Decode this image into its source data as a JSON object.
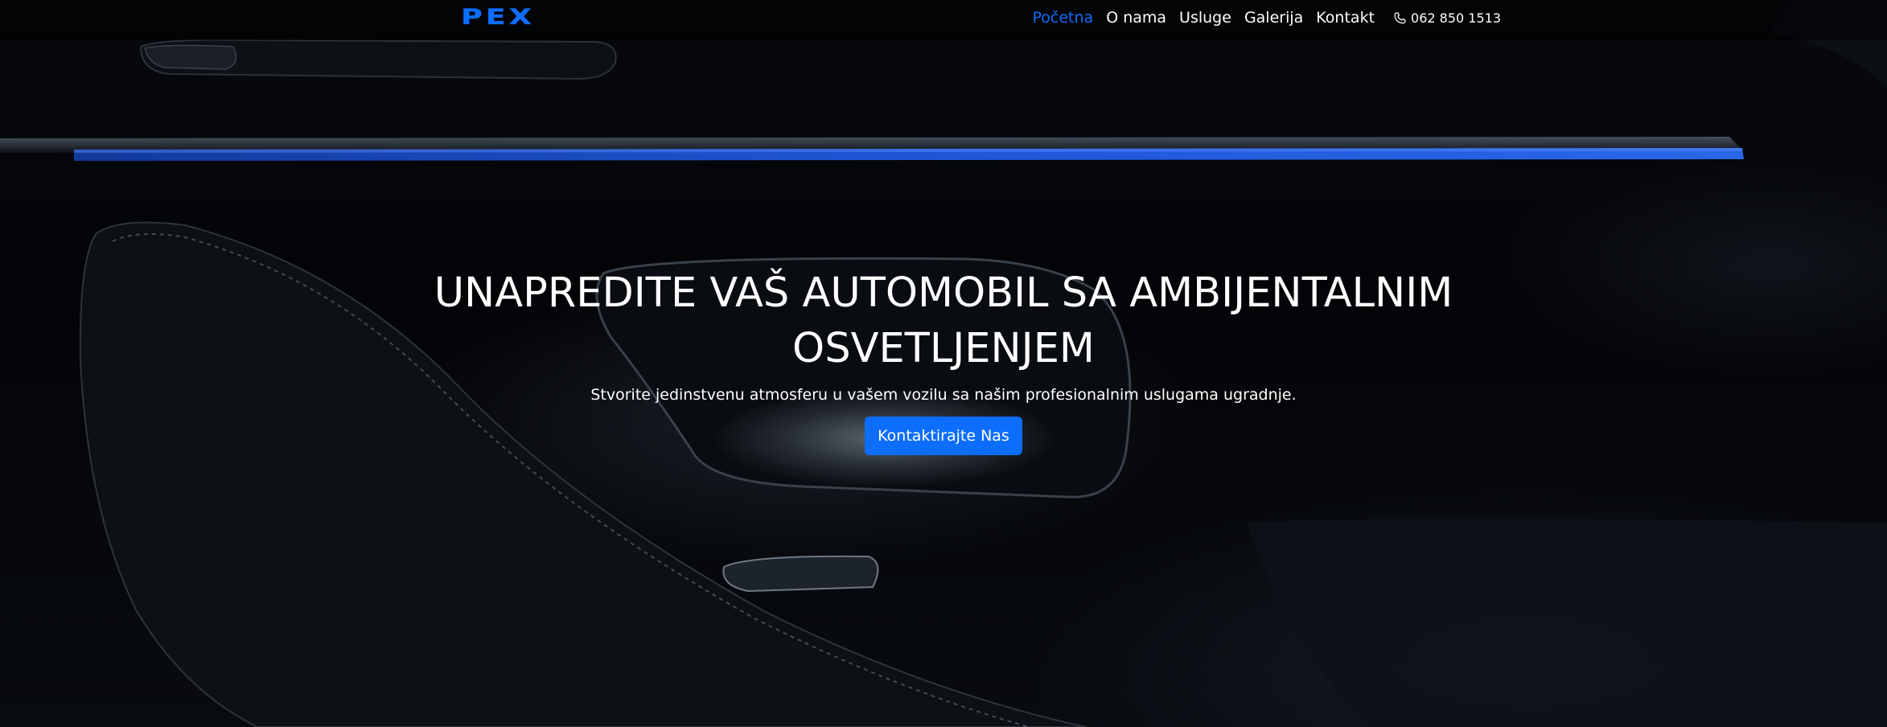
{
  "brand": {
    "logo_text": "PEX"
  },
  "nav": {
    "items": [
      {
        "label": "Početna",
        "active": true
      },
      {
        "label": "O nama",
        "active": false
      },
      {
        "label": "Usluge",
        "active": false
      },
      {
        "label": "Galerija",
        "active": false
      },
      {
        "label": "Kontakt",
        "active": false
      }
    ],
    "phone": {
      "icon": "phone-icon",
      "number": "062 850 1513"
    }
  },
  "hero": {
    "title": "UNAPREDITE VAŠ AUTOMOBIL SA AMBIJENTALNIM OSVETLJENJEM",
    "subtitle": "Stvorite jedinstvenu atmosferu u vašem vozilu sa našim profesionalnim uslugama ugradnje.",
    "cta_label": "Kontaktirajte Nas"
  },
  "colors": {
    "accent": "#0d6efd",
    "background": "#05070b",
    "text": "#ffffff"
  }
}
